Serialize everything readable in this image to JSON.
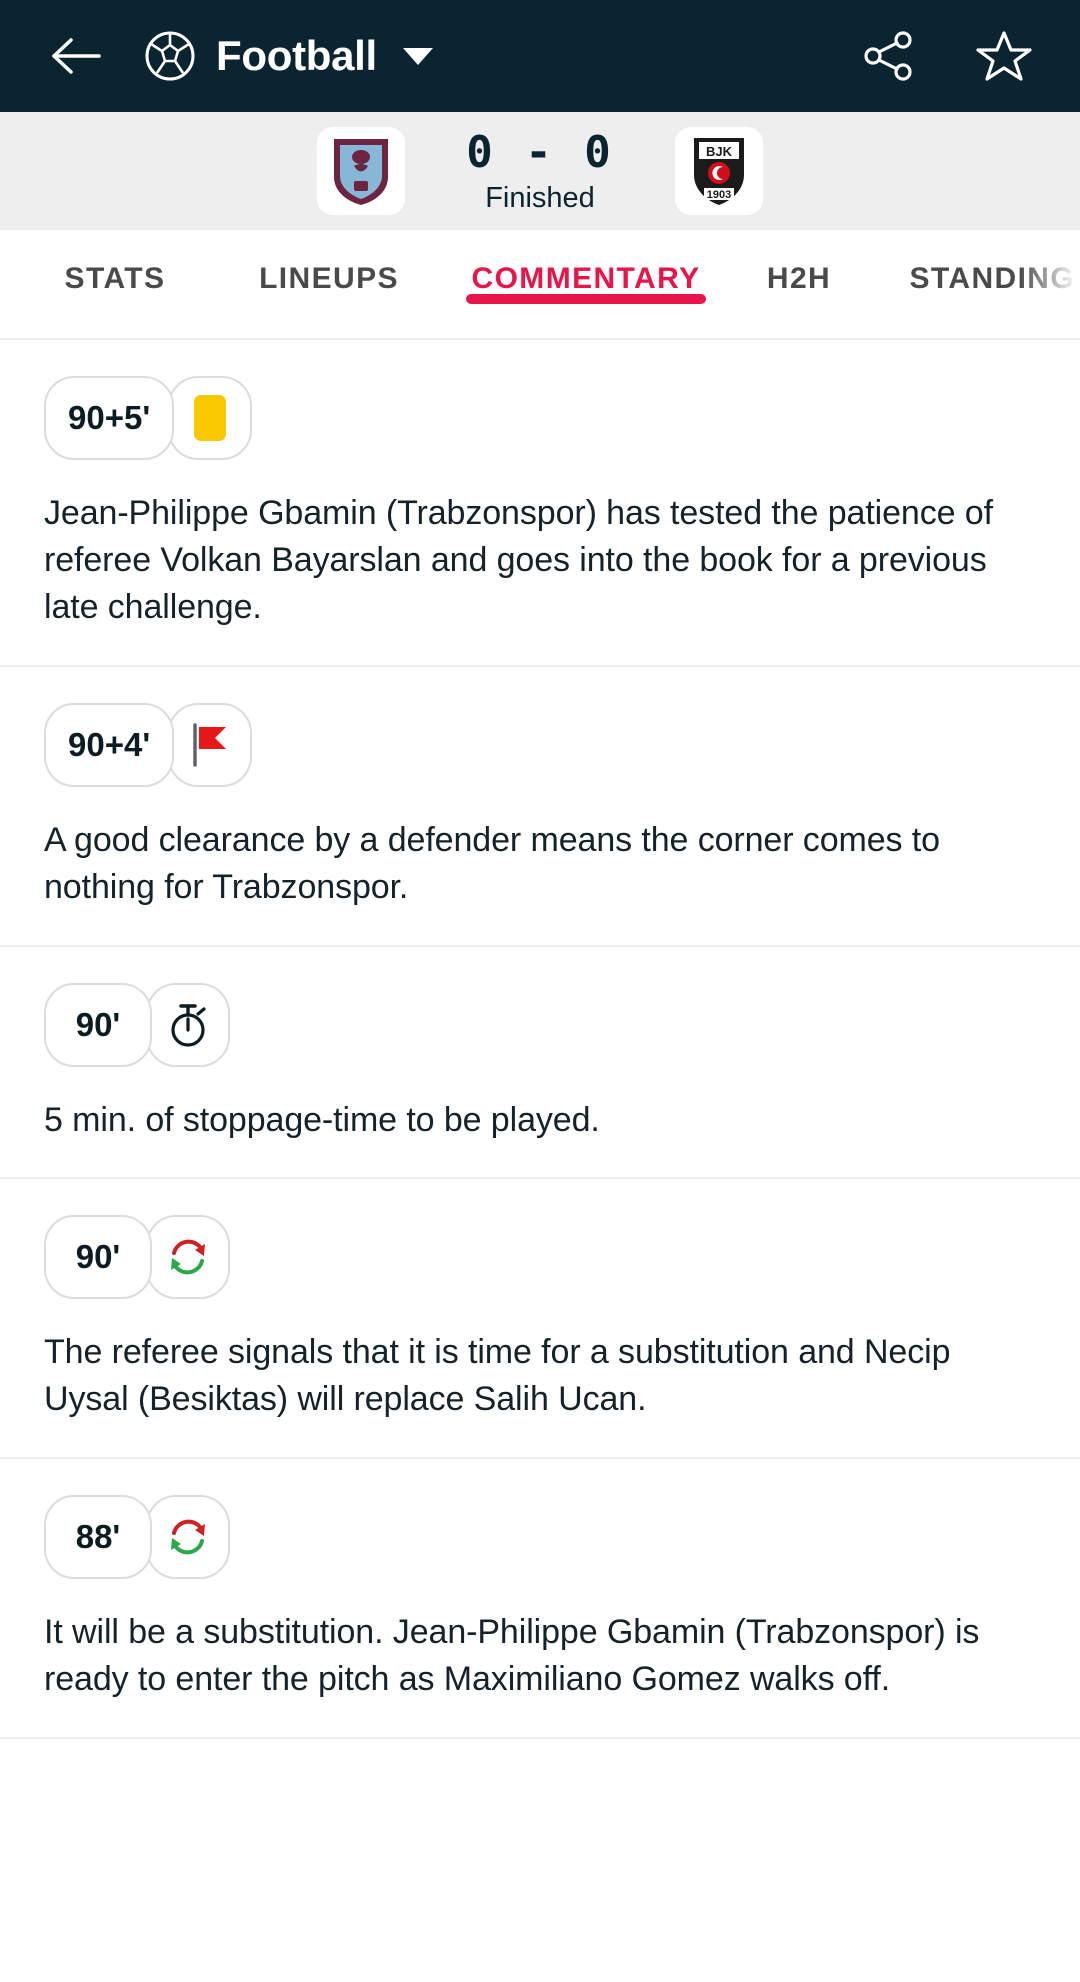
{
  "appbar": {
    "back_icon": "arrow-left-icon",
    "sport_icon": "football-icon",
    "title": "Football",
    "dropdown_icon": "chevron-down-icon",
    "share_icon": "share-icon",
    "favorite_icon": "star-icon",
    "background": "#0a2430"
  },
  "score_header": {
    "home_team": "Trabzonspor",
    "away_team": "Besiktas",
    "score": "0 - 0",
    "status": "Finished",
    "background": "#eeeeee",
    "text_color": "#0a2430"
  },
  "tabs": {
    "active_color": "#e8154a",
    "items": [
      {
        "label": "STATS",
        "active": false
      },
      {
        "label": "LINEUPS",
        "active": false
      },
      {
        "label": "COMMENTARY",
        "active": true
      },
      {
        "label": "H2H",
        "active": false
      },
      {
        "label": "STANDINGS",
        "active": false
      }
    ]
  },
  "commentary": {
    "items": [
      {
        "time": "90+5'",
        "icon": "yellow-card-icon",
        "text": "Jean-Philippe Gbamin (Trabzonspor) has tested the patience of referee Volkan Bayarslan and goes into the book for a previous late challenge."
      },
      {
        "time": "90+4'",
        "icon": "corner-flag-icon",
        "text": "A good clearance by a defender means the corner comes to nothing for Trabzonspor."
      },
      {
        "time": "90'",
        "icon": "stopwatch-icon",
        "text": "5 min. of stoppage-time to be played."
      },
      {
        "time": "90'",
        "icon": "substitution-icon",
        "text": "The referee signals that it is time for a substitution and Necip Uysal (Besiktas) will replace Salih Ucan."
      },
      {
        "time": "88'",
        "icon": "substitution-icon",
        "text": "It will be a substitution. Jean-Philippe Gbamin (Trabzonspor) is ready to enter the pitch as Maximiliano Gomez walks off."
      }
    ]
  },
  "colors": {
    "yellow_card": "#fac800",
    "corner_flag": "#e8181a",
    "sub_in": "#2aa84a",
    "sub_out": "#cc2222",
    "stopwatch": "#0d1b22"
  }
}
